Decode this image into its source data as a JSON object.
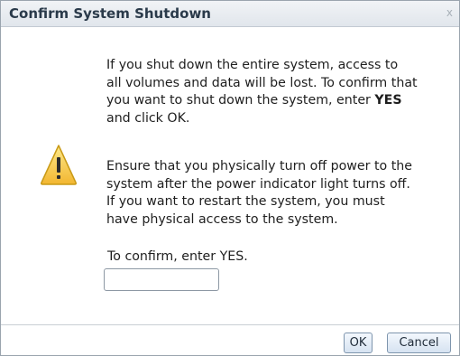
{
  "dialog": {
    "title": "Confirm System Shutdown",
    "close_label": "x"
  },
  "message1": {
    "line1": "If you shut down the entire system, access to",
    "line2": "all volumes and data will be lost. To confirm that",
    "line3": "you want to shut down the system, enter ",
    "line3_bold": "YES",
    "line4": "and click OK."
  },
  "message2": {
    "line1": "Ensure that you physically turn off power to the",
    "line2": "system after the power indicator light turns off.",
    "line3": "If you want to restart the system, you must",
    "line4": "have physical access to the system."
  },
  "confirm": {
    "label": "To confirm, enter YES.",
    "value": "",
    "placeholder": ""
  },
  "buttons": {
    "ok": "OK",
    "cancel": "Cancel"
  },
  "icon": {
    "name": "warning-icon",
    "fill_color": "#f7c948",
    "border_color": "#c99a16"
  }
}
